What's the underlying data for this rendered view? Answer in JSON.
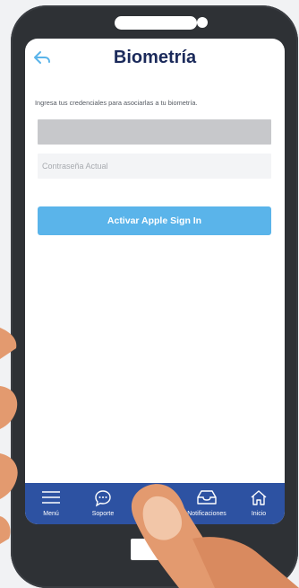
{
  "header": {
    "title": "Biometría"
  },
  "form": {
    "intro": "Ingresa tus credenciales para asociarlas a tu biometría.",
    "password_placeholder": "Contraseña Actual",
    "submit_label": "Activar Apple Sign In"
  },
  "tabbar": {
    "items": [
      {
        "label": "Menú",
        "icon": "menu-icon"
      },
      {
        "label": "Soporte",
        "icon": "chat-support-icon"
      },
      {
        "label": "",
        "icon": "hidden-by-finger"
      },
      {
        "label": "Notificaciones",
        "icon": "inbox-icon"
      },
      {
        "label": "Inicio",
        "icon": "home-icon"
      }
    ]
  },
  "colors": {
    "title": "#1b2a5b",
    "accent": "#5ab4ea",
    "tabbar": "#2d52a2",
    "phone": "#2e3135"
  }
}
